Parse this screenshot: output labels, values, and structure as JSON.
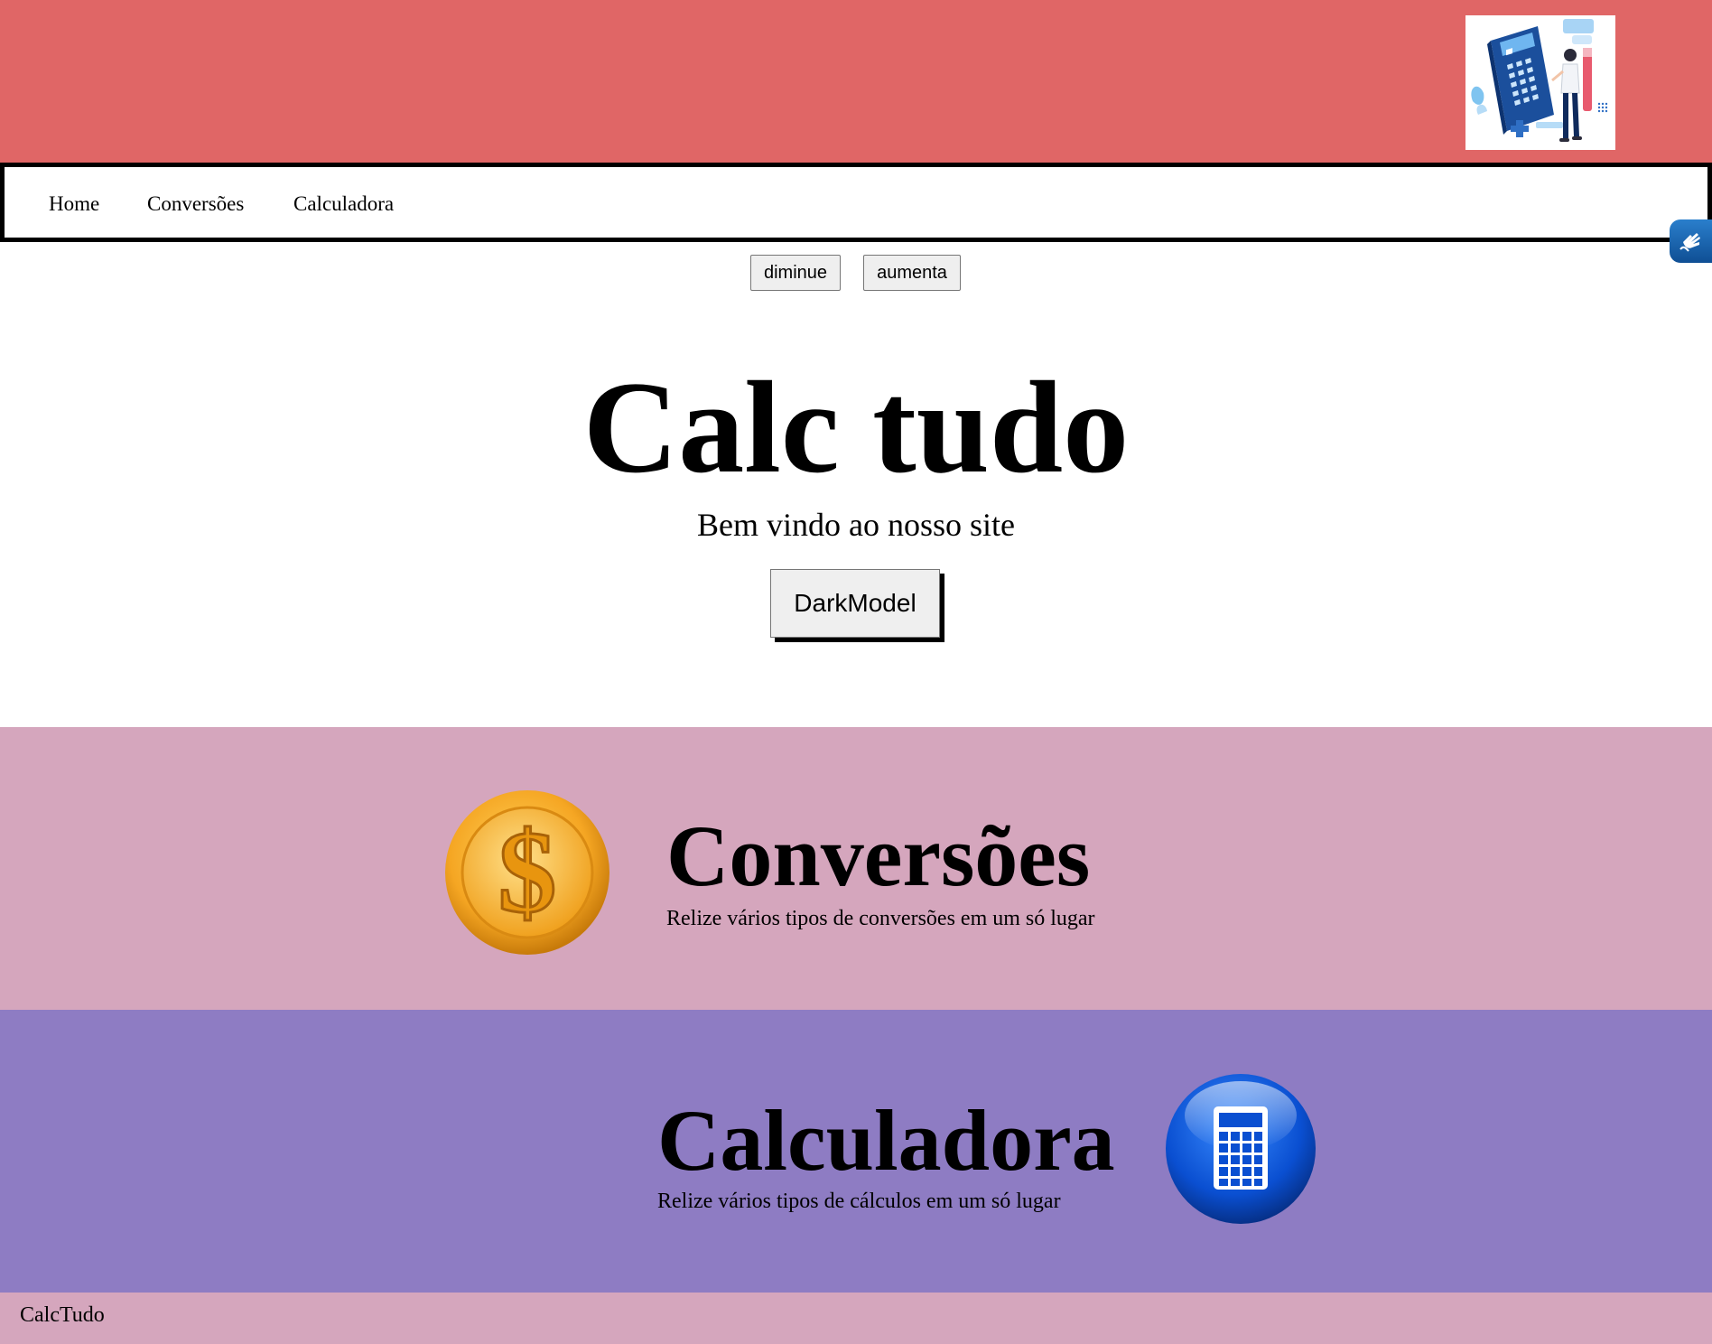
{
  "header": {
    "illustration_icon": "calculator-person-illustration"
  },
  "nav": {
    "links": [
      {
        "label": "Home"
      },
      {
        "label": "Conversões"
      },
      {
        "label": "Calculadora"
      }
    ]
  },
  "accessibility": {
    "icon": "sign-language-hand-icon"
  },
  "font_controls": {
    "decrease_label": "diminue",
    "increase_label": "aumenta"
  },
  "hero": {
    "title": "Calc tudo",
    "subtitle": "Bem vindo ao nosso site",
    "dark_mode_label": "DarkModel"
  },
  "sections": {
    "conversions": {
      "title": "Conversões",
      "description": "Relize vários tipos de conversões em um só lugar",
      "icon": "gold-coin-dollar-icon",
      "background": "#d5a6bd"
    },
    "calculator": {
      "title": "Calculadora",
      "description": "Relize vários tipos de cálculos em um só lugar",
      "icon": "blue-calculator-icon",
      "background": "#8e7cc3"
    }
  },
  "footer": {
    "text": "CalcTudo"
  },
  "colors": {
    "header_bg": "#e06666",
    "footer_bg": "#d5a6bd",
    "widget_blue": "#1565b0"
  }
}
